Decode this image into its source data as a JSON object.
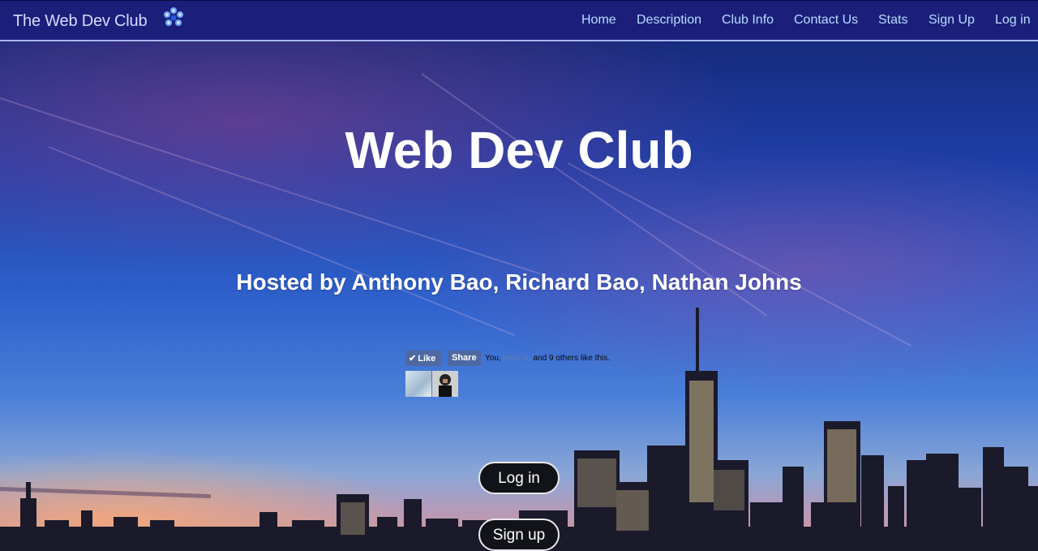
{
  "navbar": {
    "brand": "The Web Dev Club",
    "logo_icon": "blue-flower-logo-icon",
    "links": [
      {
        "label": "Home"
      },
      {
        "label": "Description"
      },
      {
        "label": "Club Info"
      },
      {
        "label": "Contact Us"
      },
      {
        "label": "Stats"
      },
      {
        "label": "Sign Up"
      },
      {
        "label": "Log in"
      }
    ]
  },
  "hero": {
    "title": "Web Dev Club",
    "subtitle": "Hosted by Anthony Bao, Richard Bao, Nathan Johns",
    "background": "city-skyline-at-dusk-photo"
  },
  "facebook": {
    "like_label": "Like",
    "share_label": "Share",
    "social_text_prefix": "You,",
    "social_text_hidden": "Hsin Yu",
    "social_text_suffix": "and 9 others like this.",
    "like_icon": "check-icon"
  },
  "buttons": {
    "login_label": "Log in",
    "signup_label": "Sign up"
  },
  "colors": {
    "navbar_bg": "#1b1f7a",
    "nav_link": "#b8dcff",
    "fb_blue": "#4e69a2",
    "button_bg": "#111319"
  }
}
